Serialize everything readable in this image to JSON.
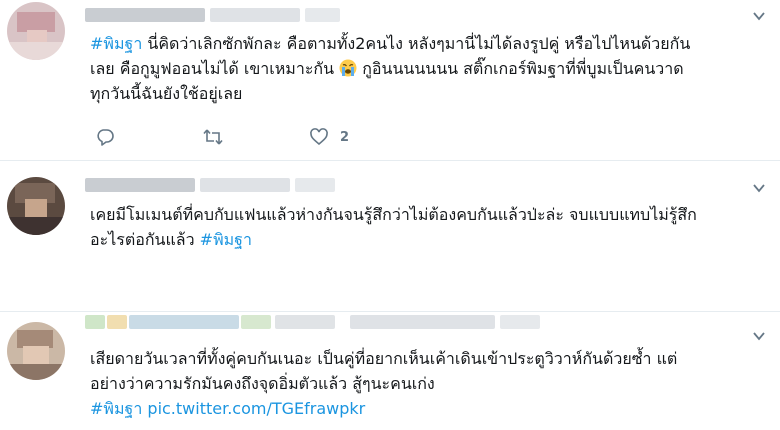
{
  "colors": {
    "accent": "#1b95e0",
    "icon": "#657786",
    "divider": "#e6ecf0"
  },
  "icons": {
    "reply": "reply-icon",
    "retweet": "retweet-icon",
    "like": "like-icon",
    "more": "chevron-down-icon",
    "emoji": "loudly-crying-face-emoji"
  },
  "tweets": [
    {
      "hashtag": "#พิมฐา",
      "text_a": " นี่คิดว่าเลิกซักพักละ คือตามทั้ง2คนไง หลังๆมานี่ไม่ได้ลงรูปคู่ หรือไปไหนด้วยกัน\nเลย คือกูมูฟออนไม่ได้ เขาเหมาะกัน ",
      "text_b": " กูอินนนนนนน สติ๊กเกอร์พิมฐาที่พี่บูมเป็นคนวาด\nทุกวันนี้ฉันยังใช้อยู่เลย",
      "reply_count": "",
      "retweet_count": "",
      "like_count": "2"
    },
    {
      "text": "เคยมีโมเมนต์ที่คบกับแฟนแล้วห่างกันจนรู้สึกว่าไม่ต้องคบกันแล้วป่ะล่ะ จบแบบแทบไม่รู้สึก\nอะไรต่อกันแล้ว ",
      "hashtag": "#พิมฐา"
    },
    {
      "text": "เสียดายวันเวลาที่ทั้งคู่คบกันเนอะ เป็นคู่ที่อยากเห็นเค้าเดินเข้าประตูวิวาห์กันด้วยซ้ำ แต่\nอย่างว่าความรักมันคงถึงจุดอิ่มตัวแล้ว สู้ๆนะคนเก่ง",
      "hashtag": "#พิมฐา",
      "link": "pic.twitter.com/TGEfrawpkr"
    }
  ]
}
